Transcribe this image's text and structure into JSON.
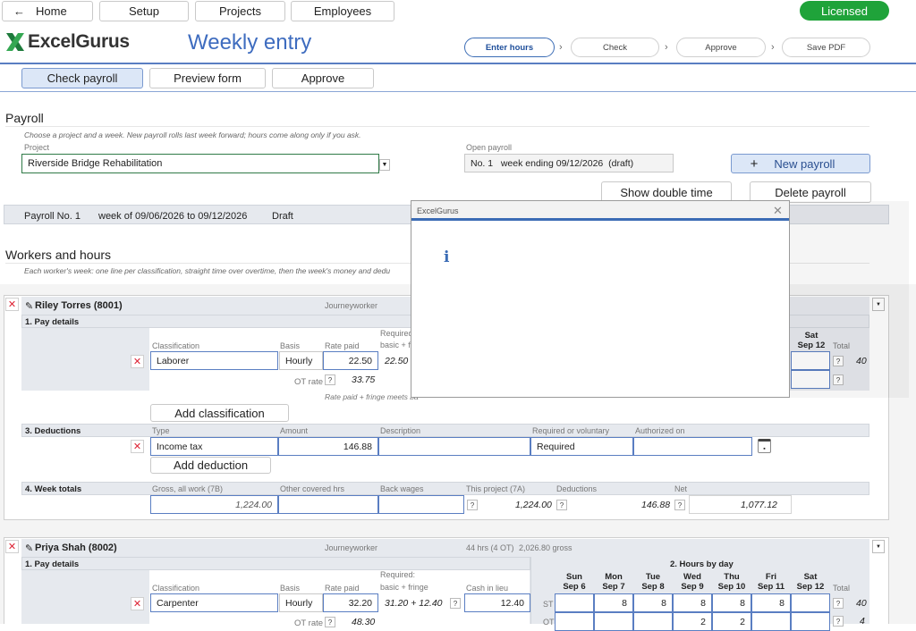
{
  "nav": {
    "home": "Home",
    "setup": "Setup",
    "projects": "Projects",
    "employees": "Employees",
    "licensed": "Licensed"
  },
  "brand": {
    "logo": "ExcelGurus",
    "page_title": "Weekly entry"
  },
  "steps": [
    "Enter hours",
    "Check",
    "Approve",
    "Save PDF"
  ],
  "subnav": {
    "check_payroll": "Check payroll",
    "preview_form": "Preview form",
    "approve": "Approve"
  },
  "payroll": {
    "heading": "Payroll",
    "hint": "Choose a project and a week. New payroll rolls last week forward; hours come along only if you ask.",
    "project_label": "Project",
    "project_value": "Riverside Bridge Rehabilitation",
    "open_label": "Open payroll",
    "open_value": "No. 1   week ending 09/12/2026  (draft)",
    "new_payroll": "New payroll",
    "show_double": "Show double time",
    "delete_payroll": "Delete payroll",
    "status_no": "Payroll No. 1",
    "status_week": "week of 09/06/2026 to 09/12/2026",
    "status_state": "Draft"
  },
  "workers": {
    "heading": "Workers and hours",
    "hint": "Each worker's week: one line per classification, straight time over overtime, then the week's money and dedu"
  },
  "worker1": {
    "name": "Riley Torres (8001)",
    "role": "Journeyworker",
    "sec_pay": "1. Pay details",
    "col_class": "Classification",
    "col_basis": "Basis",
    "col_rate": "Rate paid",
    "col_required": "Required:",
    "col_required2": "basic + f",
    "sat": "Sat",
    "sep12": "Sep 12",
    "total": "Total",
    "class_value": "Laborer",
    "basis_value": "Hourly",
    "rate_value": "22.50",
    "required_value": "22.50",
    "total_value": "40",
    "ot_rate_label": "OT rate",
    "ot_rate_value": "33.75",
    "meets_note": "Rate paid + fringe meets ba",
    "add_class": "Add classification",
    "sec_ded": "3. Deductions",
    "ded_type": "Type",
    "ded_amount": "Amount",
    "ded_desc": "Description",
    "ded_req": "Required or voluntary",
    "ded_auth": "Authorized on",
    "ded_type_value": "Income tax",
    "ded_amount_value": "146.88",
    "ded_req_value": "Required",
    "add_ded": "Add deduction",
    "sec_tot": "4. Week totals",
    "tot_gross": "Gross, all work (7B)",
    "tot_other": "Other covered hrs",
    "tot_back": "Back wages",
    "tot_project": "This project (7A)",
    "tot_deductions": "Deductions",
    "tot_net": "Net",
    "gross_value": "1,224.00",
    "project_value": "1,224.00",
    "deductions_value": "146.88",
    "net_value": "1,077.12"
  },
  "worker2": {
    "name": "Priya Shah (8002)",
    "role": "Journeyworker",
    "summary_hours": "44 hrs (4 OT)",
    "summary_gross": "2,026.80 gross",
    "sec_pay": "1. Pay details",
    "sec_hours": "2. Hours by day",
    "col_class": "Classification",
    "col_basis": "Basis",
    "col_rate": "Rate paid",
    "col_required": "Required:",
    "col_required2": "basic + fringe",
    "col_cash": "Cash in lieu",
    "days": [
      {
        "d": "Sun",
        "date": "Sep 6"
      },
      {
        "d": "Mon",
        "date": "Sep 7"
      },
      {
        "d": "Tue",
        "date": "Sep 8"
      },
      {
        "d": "Wed",
        "date": "Sep 9"
      },
      {
        "d": "Thu",
        "date": "Sep 10"
      },
      {
        "d": "Fri",
        "date": "Sep 11"
      },
      {
        "d": "Sat",
        "date": "Sep 12"
      }
    ],
    "total": "Total",
    "class_value": "Carpenter",
    "basis_value": "Hourly",
    "rate_value": "32.20",
    "required_value": "31.20 + 12.40",
    "cash_value": "12.40",
    "st_label": "ST",
    "st_hours": [
      "",
      "8",
      "8",
      "8",
      "8",
      "8",
      ""
    ],
    "st_total": "40",
    "ot_label": "OT",
    "ot_hours": [
      "",
      "",
      "",
      "2",
      "2",
      "",
      ""
    ],
    "ot_total": "4",
    "ot_rate_label": "OT rate",
    "ot_rate_value": "48.30"
  },
  "dialog": {
    "title": "ExcelGurus",
    "icon": "i"
  },
  "colors": {
    "accent": "#3b6cb5",
    "licensed": "#1fa33a",
    "band": "#e6e9ee"
  }
}
